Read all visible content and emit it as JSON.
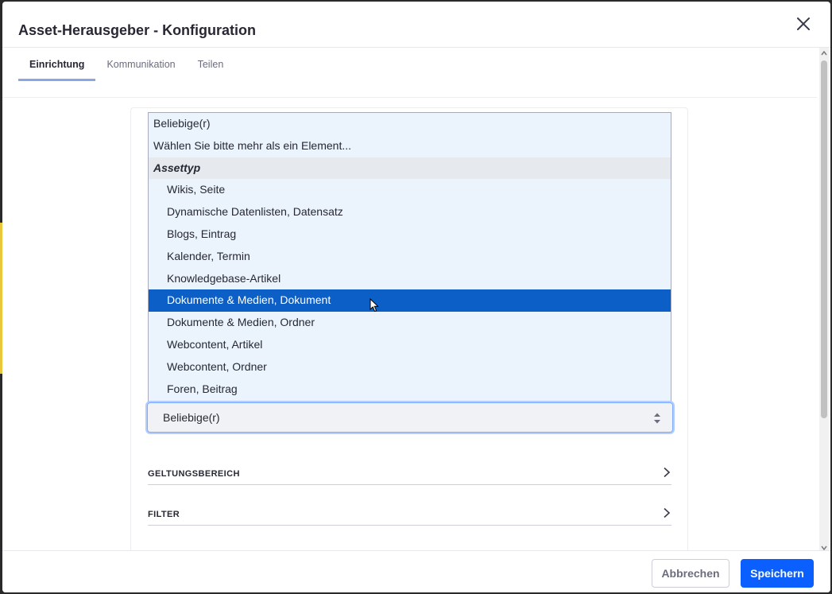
{
  "modal": {
    "title": "Asset-Herausgeber - Konfiguration"
  },
  "tabs": [
    {
      "label": "Einrichtung",
      "active": true
    },
    {
      "label": "Kommunikation",
      "active": false
    },
    {
      "label": "Teilen",
      "active": false
    }
  ],
  "asset_list": {
    "options": [
      {
        "label": "Beliebige(r)",
        "type": "option"
      },
      {
        "label": "Wählen Sie bitte mehr als ein Element...",
        "type": "option"
      },
      {
        "label": "Assettyp",
        "type": "group"
      },
      {
        "label": "Wikis, Seite",
        "type": "child"
      },
      {
        "label": "Dynamische Datenlisten, Datensatz",
        "type": "child"
      },
      {
        "label": "Blogs, Eintrag",
        "type": "child"
      },
      {
        "label": "Kalender, Termin",
        "type": "child"
      },
      {
        "label": "Knowledgebase-Artikel",
        "type": "child"
      },
      {
        "label": "Dokumente & Medien, Dokument",
        "type": "child",
        "selected": true
      },
      {
        "label": "Dokumente & Medien, Ordner",
        "type": "child"
      },
      {
        "label": "Webcontent, Artikel",
        "type": "child"
      },
      {
        "label": "Webcontent, Ordner",
        "type": "child"
      },
      {
        "label": "Foren, Beitrag",
        "type": "child"
      }
    ]
  },
  "asset_select": {
    "value": "Beliebige(r)"
  },
  "sections": {
    "scope": "GELTUNGSBEREICH",
    "filter": "FILTER"
  },
  "footer": {
    "cancel_label": "Abbrechen",
    "save_label": "Speichern"
  },
  "colors": {
    "selected_option": "#0b5fc6",
    "primary_button": "#0b5fff",
    "listbox_bg": "#ebf4fc"
  },
  "icons": {
    "close": "close-icon",
    "select": "select-arrows-icon",
    "section": "chevron-right-icon"
  }
}
